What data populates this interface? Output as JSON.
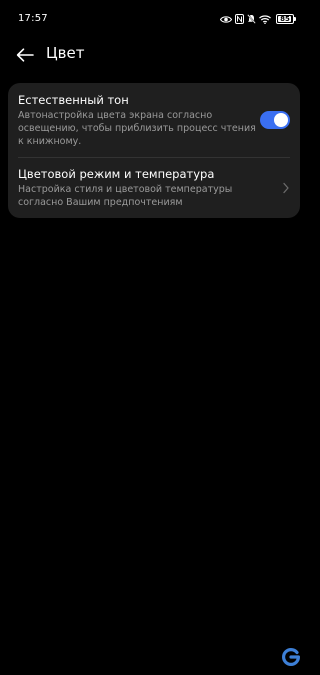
{
  "status_bar": {
    "time": "17:57",
    "battery_level": "85",
    "icons": [
      "eye-icon",
      "nfc-icon",
      "mute-icon",
      "wifi-icon",
      "battery-icon"
    ]
  },
  "header": {
    "back_icon": "arrow-left-icon",
    "title": "Цвет"
  },
  "settings": {
    "natural_tone": {
      "title": "Естественный тон",
      "description": "Автонастройка цвета экрана согласно освещению, чтобы приблизить процесс чтения к книжному.",
      "enabled": true
    },
    "color_mode": {
      "title": "Цветовой режим и температура",
      "description": "Настройка стиля и цветовой температуры согласно Вашим предпочтениям",
      "icon": "chevron-right-icon"
    }
  },
  "colors": {
    "background": "#000000",
    "card": "#1f1f1f",
    "accent": "#3a6ff2",
    "secondary_text": "#9a9a9a",
    "watermark": "#3d7fd6"
  }
}
